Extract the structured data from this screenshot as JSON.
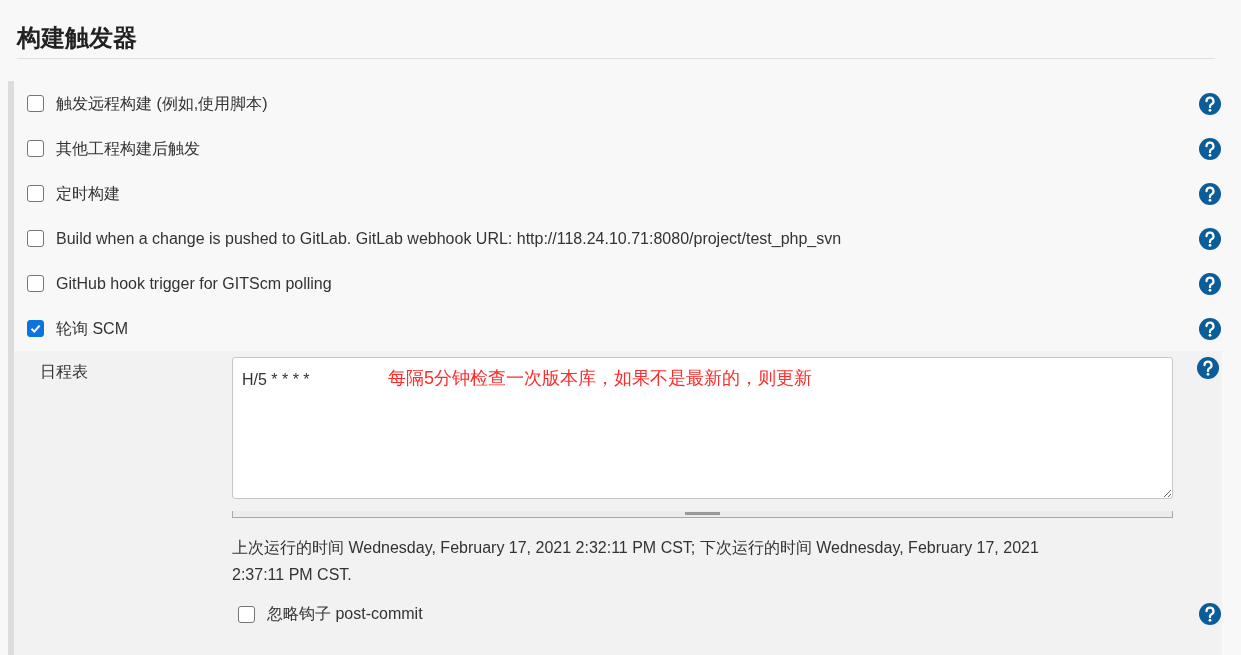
{
  "section_title": "构建触发器",
  "triggers": [
    {
      "label": "触发远程构建 (例如,使用脚本)",
      "checked": false
    },
    {
      "label": "其他工程构建后触发",
      "checked": false
    },
    {
      "label": "定时构建",
      "checked": false
    },
    {
      "label": "Build when a change is pushed to GitLab. GitLab webhook URL: http://118.24.10.71:8080/project/test_php_svn",
      "checked": false
    },
    {
      "label": "GitHub hook trigger for GITScm polling",
      "checked": false
    },
    {
      "label": "轮询 SCM",
      "checked": true
    }
  ],
  "schedule": {
    "label": "日程表",
    "value": "H/5 * * * *",
    "annotation": "每隔5分钟检查一次版本库，如果不是最新的，则更新",
    "status": "上次运行的时间 Wednesday, February 17, 2021 2:32:11 PM CST; 下次运行的时间 Wednesday, February 17, 2021 2:37:11 PM CST."
  },
  "ignore_post_commit": {
    "label": "忽略钩子 post-commit",
    "checked": false
  }
}
